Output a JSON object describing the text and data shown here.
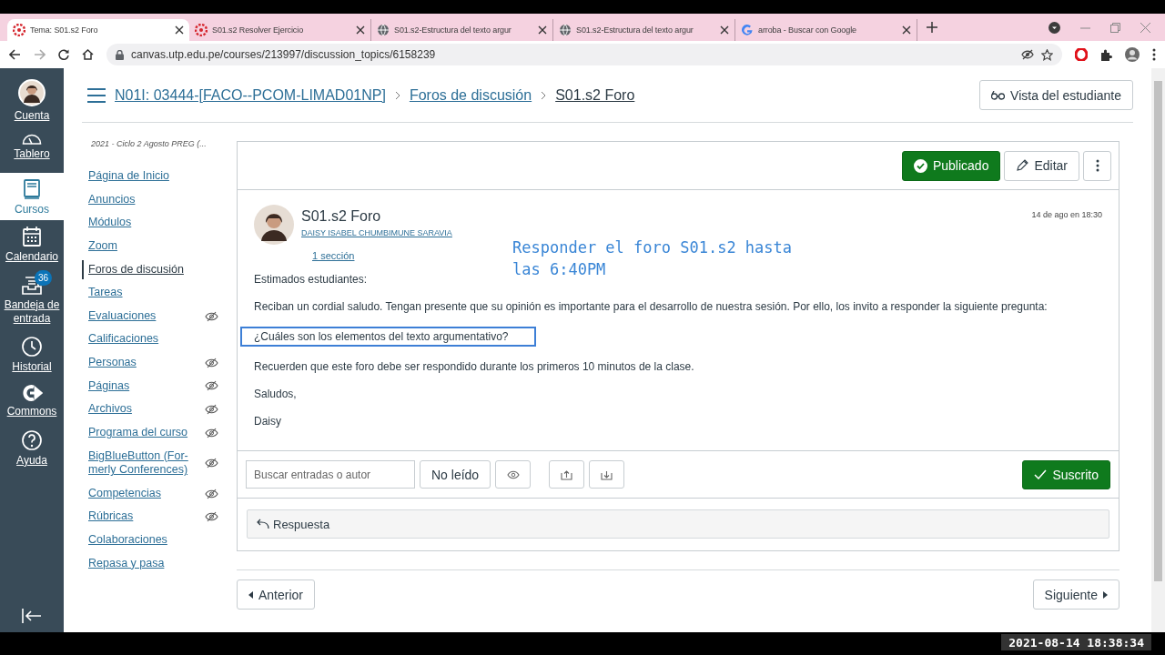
{
  "browser": {
    "tabs": [
      {
        "title": "Tema: S01.s2 Foro",
        "kind": "canvas",
        "selected": true
      },
      {
        "title": "S01.s2 Resolver Ejercicio",
        "kind": "canvas",
        "selected": false
      },
      {
        "title": "S01.s2-Estructura del texto argur",
        "kind": "globe",
        "selected": false
      },
      {
        "title": "S01.s2-Estructura del texto argur",
        "kind": "globe",
        "selected": false
      },
      {
        "title": "arroba - Buscar con Google",
        "kind": "google",
        "selected": false
      }
    ],
    "url": "canvas.utp.edu.pe/courses/213997/discussion_topics/6158239"
  },
  "global_nav": {
    "items": [
      {
        "label": "Cuenta",
        "kind": "avatar",
        "selected": false
      },
      {
        "label": "Tablero",
        "kind": "dashboard",
        "selected": false
      },
      {
        "label": "Cursos",
        "kind": "courses",
        "selected": true
      },
      {
        "label": "Calendario",
        "kind": "calendar",
        "selected": false
      },
      {
        "label": "Bandeja de entrada",
        "kind": "inbox",
        "badge": "36",
        "selected": false
      },
      {
        "label": "Historial",
        "kind": "history",
        "selected": false
      },
      {
        "label": "Commons",
        "kind": "commons",
        "selected": false
      },
      {
        "label": "Ayuda",
        "kind": "help",
        "selected": false
      }
    ]
  },
  "breadcrumbs": [
    "N01I: 03444-[FACO--PCOM-LIMAD01NP]",
    "Foros de discusión",
    "S01.s2 Foro"
  ],
  "student_view_button": "Vista del estudiante",
  "course_nav": {
    "term": "2021 - Ciclo 2 Agosto PREG (...",
    "items": [
      {
        "label": "Página de Inicio",
        "selected": false,
        "hidden": false
      },
      {
        "label": "Anuncios",
        "selected": false,
        "hidden": false
      },
      {
        "label": "Módulos",
        "selected": false,
        "hidden": false
      },
      {
        "label": "Zoom",
        "selected": false,
        "hidden": false
      },
      {
        "label": "Foros de discusión",
        "selected": true,
        "hidden": false
      },
      {
        "label": "Tareas",
        "selected": false,
        "hidden": false
      },
      {
        "label": "Evaluaciones",
        "selected": false,
        "hidden": true
      },
      {
        "label": "Calificaciones",
        "selected": false,
        "hidden": false
      },
      {
        "label": "Personas",
        "selected": false,
        "hidden": true
      },
      {
        "label": "Páginas",
        "selected": false,
        "hidden": true
      },
      {
        "label": "Archivos",
        "selected": false,
        "hidden": true
      },
      {
        "label": "Programa del curso",
        "selected": false,
        "hidden": true
      },
      {
        "label": "BigBlueButton (For-merly Conferences)",
        "selected": false,
        "hidden": true
      },
      {
        "label": "Competencias",
        "selected": false,
        "hidden": true
      },
      {
        "label": "Rúbricas",
        "selected": false,
        "hidden": true
      },
      {
        "label": "Colaboraciones",
        "selected": false,
        "hidden": false
      },
      {
        "label": "Repasa y pasa",
        "selected": false,
        "hidden": false
      }
    ]
  },
  "topic": {
    "published_button": "Publicado",
    "edit_button": "Editar",
    "title": "S01.s2 Foro",
    "author": "DAISY ISABEL CHUMBIMUNE SARAVIA",
    "sections_link": "1 sección",
    "date": "14 de ago en 18:30",
    "overlay_note": "Responder el foro S01.s2 hasta las 6:40PM",
    "paragraphs": [
      {
        "text": "Estimados estudiantes:",
        "highlighted": false
      },
      {
        "text": "Reciban un cordial saludo. Tengan presente que su opinión es importante para el desarrollo de nuestra sesión. Por ello, los invito a responder la siguiente pregunta:",
        "highlighted": false
      },
      {
        "text": "¿Cuáles son los elementos del texto argumentativo?",
        "highlighted": true
      },
      {
        "text": "Recuerden que este foro debe ser respondido durante los primeros 10 minutos de la clase.",
        "highlighted": false
      },
      {
        "text": "Saludos,",
        "highlighted": false
      },
      {
        "text": "Daisy",
        "highlighted": false
      }
    ],
    "search": {
      "placeholder": "Buscar entradas o autor"
    },
    "unread_button": "No leído",
    "subscribed_button": "Suscrito",
    "reply_button": "Respuesta"
  },
  "pager": {
    "previous": "Anterior",
    "next": "Siguiente"
  },
  "recording_timestamp": "2021-08-14 18:38:34"
}
